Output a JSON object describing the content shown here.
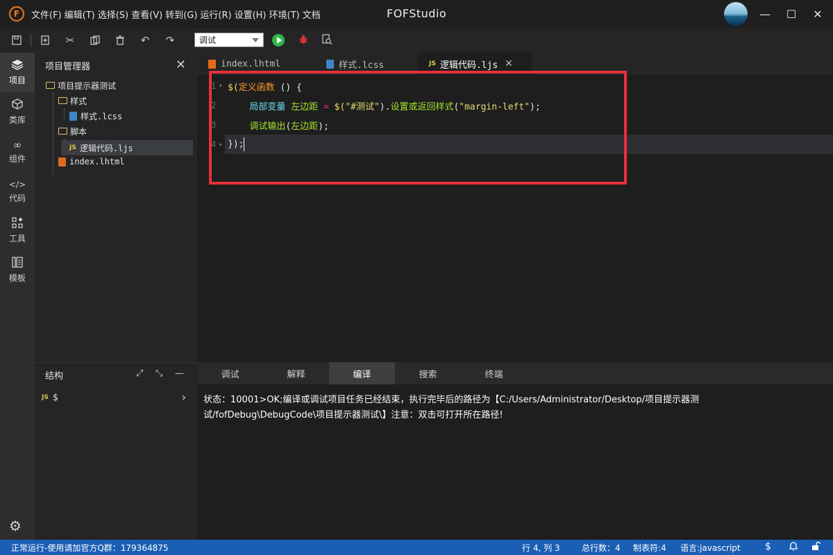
{
  "app": {
    "logo_letter": "F",
    "title": "FOFStudio",
    "menu": [
      "文件(F)",
      "编辑(T)",
      "选择(S)",
      "查看(V)",
      "转到(G)",
      "运行(R)",
      "设置(H)",
      "环境(T)",
      "文档"
    ],
    "window_controls": {
      "minimize": "—",
      "maximize": "☐",
      "close": "✕"
    }
  },
  "toolbar": {
    "icons": [
      "save-icon",
      "new-file-icon",
      "cut-icon",
      "copy-icon",
      "delete-icon",
      "undo-icon",
      "redo-icon"
    ],
    "mode_value": "调试",
    "run_icon": "play-icon",
    "debug_icon": "bug-icon",
    "inspect_icon": "search-doc-icon"
  },
  "activity_bar": [
    {
      "label": "项目",
      "icon": "layers-icon",
      "active": true
    },
    {
      "label": "类库",
      "icon": "cube-icon",
      "active": false
    },
    {
      "label": "组件",
      "icon": "infinity-icon",
      "active": false
    },
    {
      "label": "代码",
      "icon": "code-icon",
      "active": false
    },
    {
      "label": "工具",
      "icon": "tools-icon",
      "active": false
    },
    {
      "label": "模板",
      "icon": "template-icon",
      "active": false
    }
  ],
  "project_panel": {
    "title": "项目管理器",
    "tree": [
      {
        "label": "项目提示器测试",
        "type": "folder",
        "depth": 0
      },
      {
        "label": "样式",
        "type": "folder",
        "depth": 1
      },
      {
        "label": "样式.lcss",
        "type": "css",
        "depth": 2
      },
      {
        "label": "脚本",
        "type": "folder",
        "depth": 1
      },
      {
        "label": "逻辑代码.ljs",
        "type": "js",
        "depth": 2,
        "selected": true
      },
      {
        "label": "index.lhtml",
        "type": "html",
        "depth": 1
      }
    ]
  },
  "structure_panel": {
    "title": "结构",
    "row_badge": "JS",
    "row_label": "$"
  },
  "editor_tabs": [
    {
      "label": "index.lhtml",
      "type": "html",
      "active": false
    },
    {
      "label": "样式.lcss",
      "type": "css",
      "active": false
    },
    {
      "label": "逻辑代码.ljs",
      "type": "js",
      "active": true
    }
  ],
  "editor": {
    "lines": [
      {
        "num": "1",
        "fold": "▾"
      },
      {
        "num": "2",
        "fold": ""
      },
      {
        "num": "3",
        "fold": ""
      },
      {
        "num": "4",
        "fold": "▴"
      }
    ],
    "code": {
      "l1_a": "$(",
      "l1_b": "定义函数",
      "l1_c": " () {",
      "l2_indent": "    ",
      "l2_kw": "局部变量",
      "l2_var": " 左边距 ",
      "l2_op": "=",
      "l2_fn": " $(",
      "l2_str": "\"#测试\"",
      "l2_p": ").",
      "l2_method": "设置或返回样式",
      "l2_p2": "(",
      "l2_str2": "\"margin-left\"",
      "l2_end": ");",
      "l3_indent": "    ",
      "l3_fn": "调试输出",
      "l3_p": "(",
      "l3_var": "左边距",
      "l3_end": ");",
      "l4": "});"
    }
  },
  "bottom_panel": {
    "tabs": [
      "调试",
      "解释",
      "编译",
      "搜索",
      "终端"
    ],
    "active_tab": "编译",
    "output": "状态：10001>OK;编译或调试项目任务已经结束，执行完毕后的路径为【C:/Users/Administrator/Desktop/项目提示器测试/fofDebug\\DebugCode\\项目提示器测试\\】注意：双击可打开所在路径!"
  },
  "statusbar": {
    "left": "正常运行-使用请加官方Q群：179364875",
    "position": "行 4, 列 3",
    "total": "总行数：4",
    "tab": "制表符:4",
    "language": "语言:javascript"
  }
}
